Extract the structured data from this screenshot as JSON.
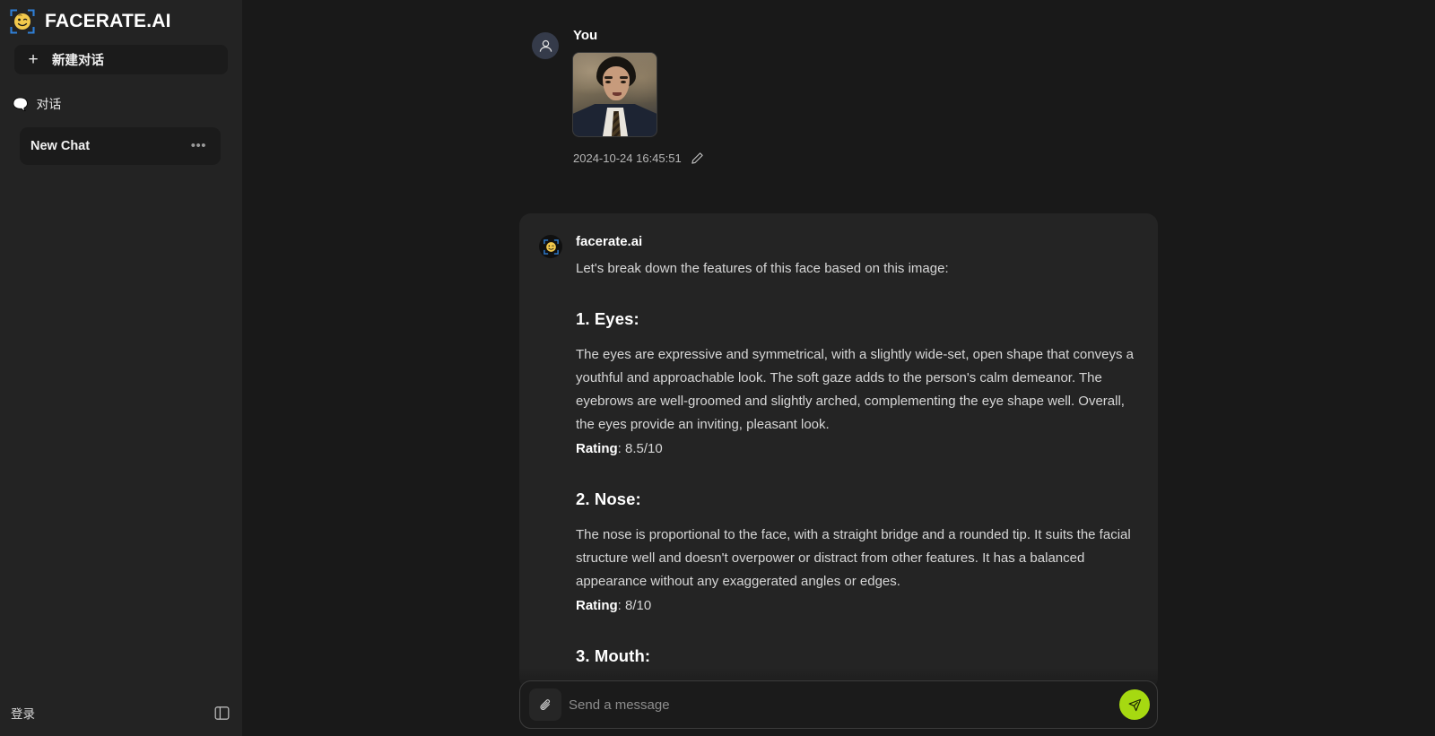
{
  "brand": {
    "title": "FACERATE.AI",
    "logo_icon": "face-scan-logo-icon"
  },
  "sidebar": {
    "new_chat_label": "新建对话",
    "plus_icon": "+",
    "section": {
      "icon": "speech-bubble-icon",
      "title": "对话"
    },
    "chats": [
      {
        "label": "New Chat",
        "menu_icon": "•••"
      }
    ],
    "footer": {
      "login_label": "登录",
      "panel_toggle_icon": "sidebar-panel-icon"
    }
  },
  "conversation": {
    "user_message": {
      "author": "You",
      "avatar_icon": "user-avatar-icon",
      "attachment_alt": "uploaded portrait photo",
      "timestamp": "2024-10-24 16:45:51",
      "edit_icon": "pencil-edit-icon"
    },
    "assistant_message": {
      "author": "facerate.ai",
      "avatar_icon": "facerate-bot-avatar-icon",
      "intro": "Let's break down the features of this face based on this image:",
      "sections": [
        {
          "title": "1. Eyes:",
          "body": "The eyes are expressive and symmetrical, with a slightly wide-set, open shape that conveys a youthful and approachable look. The soft gaze adds to the person's calm demeanor. The eyebrows are well-groomed and slightly arched, complementing the eye shape well. Overall, the eyes provide an inviting, pleasant look.",
          "rating_label": "Rating",
          "rating_value": ": 8.5/10"
        },
        {
          "title": "2. Nose:",
          "body": "The nose is proportional to the face, with a straight bridge and a rounded tip. It suits the facial structure well and doesn't overpower or distract from other features. It has a balanced appearance without any exaggerated angles or edges.",
          "rating_label": "Rating",
          "rating_value": ": 8/10"
        },
        {
          "title": "3. Mouth:",
          "body": "",
          "rating_label": "",
          "rating_value": ""
        }
      ]
    }
  },
  "composer": {
    "attach_icon": "paperclip-icon",
    "placeholder": "Send a message",
    "value": "",
    "send_icon": "send-plane-icon"
  },
  "colors": {
    "page_bg": "#191919",
    "sidebar_bg": "#232323",
    "card_bg": "#242424",
    "accent_send": "#a6d911",
    "logo_frame": "#2f7fd6",
    "logo_face": "#f2c94c"
  }
}
